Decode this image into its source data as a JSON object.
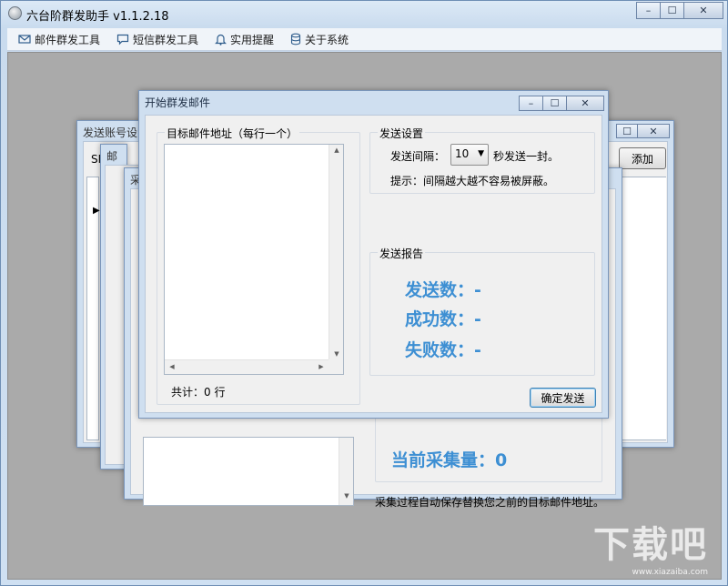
{
  "app": {
    "title": "六台阶群发助手 v1.1.2.18",
    "caption_min": "–",
    "caption_max": "☐",
    "caption_close": "✕"
  },
  "menu": {
    "items": [
      {
        "label": "邮件群发工具",
        "icon": "envelope-icon"
      },
      {
        "label": "短信群发工具",
        "icon": "chat-bubble-icon"
      },
      {
        "label": "实用提醒",
        "icon": "bell-icon"
      },
      {
        "label": "关于系统",
        "icon": "database-icon"
      }
    ]
  },
  "background_windows": {
    "account": {
      "title_fragment": "发送账号设",
      "add_label": "添加",
      "text_fragment": "SM"
    },
    "content": {
      "title_fragment": "邮件内",
      "row_marker": "▶"
    },
    "collect": {
      "title_fragment": "采",
      "count_label": "当前采集量：0",
      "note": "采集过程自动保存替换您之前的目标邮件地址。"
    }
  },
  "dialog": {
    "title": "开始群发邮件",
    "target_group": "目标邮件地址（每行一个）",
    "target_count": "共计：0 行",
    "settings_group": "发送设置",
    "interval_label": "发送间隔：",
    "interval_value": "10",
    "interval_suffix": "秒发送一封。",
    "hint": "提示：间隔越大越不容易被屏蔽。",
    "report_group": "发送报告",
    "sent_label": "发送数：-",
    "success_label": "成功数：-",
    "fail_label": "失败数：-",
    "confirm_button": "确定发送"
  },
  "watermark": {
    "main": "下载吧",
    "sub": "www.xiazaiba.com"
  },
  "colors": {
    "accent": "#3d8fd3",
    "mdi_background": "#aaaaaa"
  }
}
